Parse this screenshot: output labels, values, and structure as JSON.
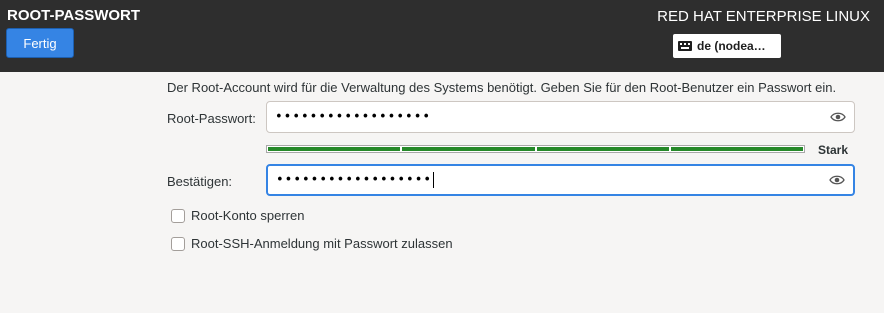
{
  "header": {
    "title": "ROOT-PASSWORT",
    "done_label": "Fertig",
    "product": "RED HAT ENTERPRISE LINUX",
    "keyboard": "de (nodea…"
  },
  "main": {
    "info": "Der Root-Account wird für die Verwaltung des Systems benötigt.  Geben Sie für den Root-Benutzer ein Passwort ein.",
    "password_label": "Root-Passwort:",
    "password_value": "••••••••••••••••••",
    "strength_label": "Stark",
    "strength_level": 1.0,
    "confirm_label": "Bestätigen:",
    "confirm_value": "••••••••••••••••••",
    "lock_label": "Root-Konto sperren",
    "ssh_label": "Root-SSH-Anmeldung mit Passwort zulassen"
  },
  "colors": {
    "header_bg": "#2e2e2e",
    "accent": "#3584e4",
    "strength": "#26892a"
  },
  "icons": [
    "keyboard-icon",
    "eye-icon"
  ]
}
